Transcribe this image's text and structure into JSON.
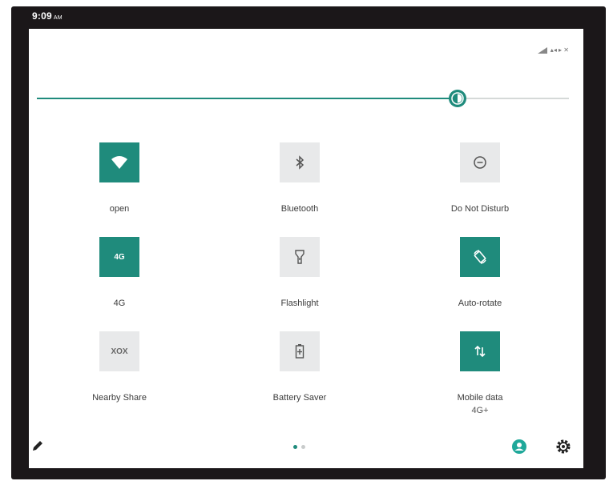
{
  "status_bar": {
    "time": "9:09",
    "ampm": "AM",
    "status_icons_text": "▴◂ ▸ ✕"
  },
  "brightness": {
    "level_percent": 79
  },
  "tiles": [
    {
      "label": "open",
      "sub": "",
      "icon": "wifi-icon",
      "on": true
    },
    {
      "label": "Bluetooth",
      "sub": "",
      "icon": "bluetooth-icon",
      "on": false
    },
    {
      "label": "Do Not Disturb",
      "sub": "",
      "icon": "do-not-disturb-icon",
      "on": false
    },
    {
      "label": "4G",
      "sub": "",
      "icon": "4g-icon",
      "icon_text": "4G",
      "on": true
    },
    {
      "label": "Flashlight",
      "sub": "",
      "icon": "flashlight-icon",
      "on": false
    },
    {
      "label": "Auto-rotate",
      "sub": "",
      "icon": "auto-rotate-icon",
      "on": true
    },
    {
      "label": "Nearby Share",
      "sub": "",
      "icon": "nearby-share-icon",
      "icon_text": "XOX",
      "on": false
    },
    {
      "label": "Battery Saver",
      "sub": "",
      "icon": "battery-saver-icon",
      "on": false
    },
    {
      "label": "Mobile data",
      "sub": "4G+",
      "icon": "mobile-data-icon",
      "on": true
    }
  ],
  "pagination": {
    "pages": 2,
    "current": 1
  },
  "colors": {
    "accent": "#1f8b7c",
    "tile_off": "#e8e9ea",
    "frame": "#1b1719"
  }
}
